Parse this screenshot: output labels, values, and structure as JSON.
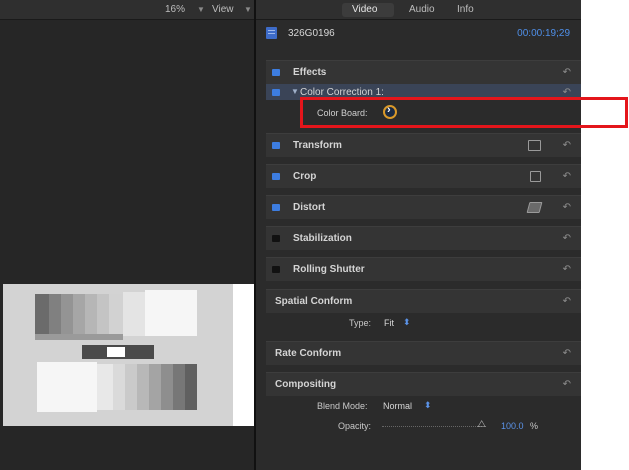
{
  "viewer": {
    "zoom": "16%",
    "view_menu": "View"
  },
  "inspector": {
    "tabs": [
      "Video",
      "Audio",
      "Info"
    ],
    "active_tab": "Video",
    "clip_name": "326G0196",
    "timecode": "00:00:19;29",
    "effects": {
      "label": "Effects",
      "enabled": true
    },
    "color_correction": {
      "label": "Color Correction 1:",
      "enabled": true,
      "expanded": true
    },
    "color_board": {
      "label": "Color Board:"
    },
    "sections": [
      {
        "label": "Transform",
        "enabled": true,
        "icon": "transform-icon"
      },
      {
        "label": "Crop",
        "enabled": true,
        "icon": "crop-icon"
      },
      {
        "label": "Distort",
        "enabled": true,
        "icon": "distort-icon"
      },
      {
        "label": "Stabilization",
        "enabled": false
      },
      {
        "label": "Rolling Shutter",
        "enabled": false
      }
    ],
    "spatial_conform": {
      "label": "Spatial Conform",
      "type_label": "Type:",
      "type_value": "Fit"
    },
    "rate_conform": {
      "label": "Rate Conform"
    },
    "compositing": {
      "label": "Compositing",
      "blend_label": "Blend Mode:",
      "blend_value": "Normal",
      "opacity_label": "Opacity:",
      "opacity_value": "100.0",
      "opacity_unit": "%"
    },
    "reset_glyph": "↶",
    "stepper_glyph": "⬍"
  },
  "colors": {
    "accent_blue": "#3d7de0",
    "timecode_blue": "#4f8fe8",
    "highlight_red": "#e4151b",
    "color_board_ring": "#d9992a"
  }
}
